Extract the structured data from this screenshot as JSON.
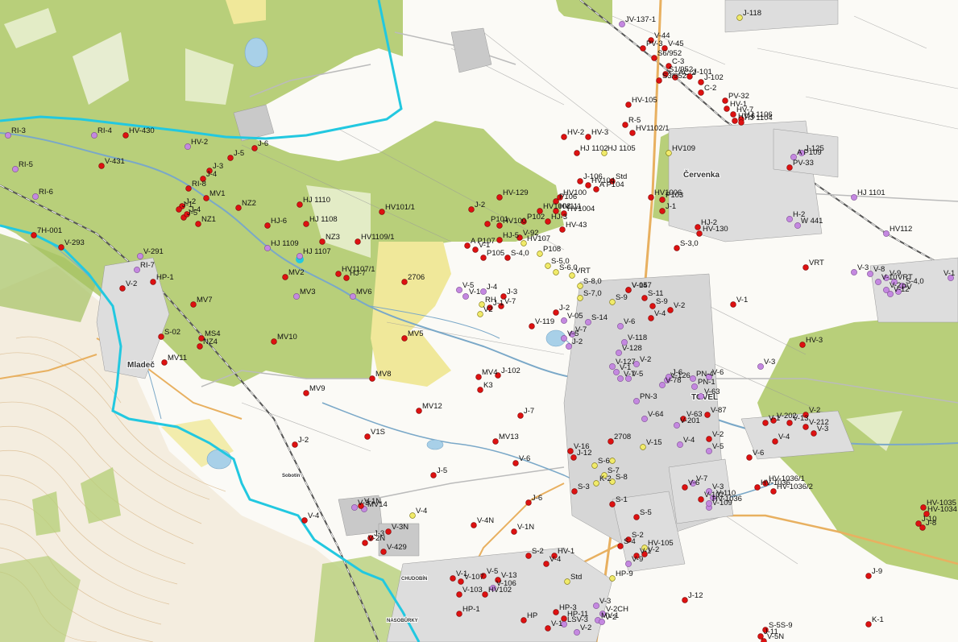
{
  "map": {
    "colors": {
      "forest": "#b8cf7a",
      "forest_dark": "#a5c262",
      "field": "#fbfaf6",
      "boundary": "#22c8e0",
      "river": "#7aa8c8",
      "borehole": "#dd1111",
      "piezometer": "#c488e0",
      "spring": "#f0ea6a",
      "settlement": "#c9c9c9"
    },
    "places": [
      {
        "id": "mladec",
        "text": "Mladeč"
      },
      {
        "id": "cervenka",
        "text": "Červenka"
      },
      {
        "id": "litovel",
        "text": "TOVEL"
      },
      {
        "id": "sobotin",
        "text": "Sobotín"
      },
      {
        "id": "chudobin",
        "text": "CHUDOBÍN"
      },
      {
        "id": "nasobuky",
        "text": "NASOBŮRKY"
      }
    ],
    "labels": [
      "JV-137-1",
      "J-118",
      "V-44",
      "PV-3",
      "V-45",
      "S6/952",
      "C-3",
      "J-101",
      "J-102",
      "S3/952",
      "AC-2",
      "S1/952",
      "C-2",
      "PV-32",
      "HV-105",
      "HV-7",
      "HJ 1106",
      "HV-1",
      "R-5",
      "HV-6",
      "HJ 1104",
      "HV-2",
      "HV-3",
      "HV1102/1",
      "HJ 1102",
      "HJ 1105",
      "HV109",
      "A P109",
      "J-125",
      "PV-33",
      "J-106",
      "Std",
      "HV104",
      "A P104",
      "HV1006",
      "HJ 1101",
      "HV-129",
      "P106",
      "HV100",
      "P103",
      "J-1",
      "J-2",
      "HV1008",
      "HV111",
      "HV1004",
      "H-2",
      "W 441",
      "HJ-2",
      "HV101/1",
      "P101",
      "HV100",
      "HJ-3",
      "P102",
      "HV-43",
      "HV-130",
      "HV112",
      "HJ-5",
      "V-92",
      "HV107",
      "A P107",
      "V-1",
      "S-3,0",
      "P108",
      "P105",
      "S-4,0",
      "S-5,0",
      "S-6,0",
      "VRT",
      "VRT",
      "V-3",
      "V-8",
      "V-9",
      "VRT",
      "V-2",
      "V-10",
      "PV",
      "V-1",
      "V-12",
      "S-4,0",
      "S-8,0",
      "V-157",
      "V-5",
      "V-1",
      "J-4",
      "J-3",
      "V-7",
      "RH",
      "V2",
      "J-1",
      "J-2",
      "S-7,0",
      "S-9",
      "S-11",
      "S-9",
      "V-2",
      "V-1",
      "V-04",
      "V-05",
      "S-14",
      "V-4",
      "V-6",
      "V-7",
      "V-5",
      "J-2",
      "V-119",
      "V-118",
      "V-128",
      "V-2",
      "V-1",
      "V-127",
      "V-5",
      "V-126",
      "V-7",
      "J-6",
      "PN-4",
      "V-6",
      "V-78",
      "PN-3",
      "PN-1",
      "V-63",
      "V-64",
      "V-63",
      "V-201",
      "V-87",
      "V-1",
      "V-202",
      "V-2",
      "V-3",
      "HV-3",
      "V-13",
      "V-212",
      "V-3",
      "V-4",
      "V-2",
      "V-4",
      "V-5",
      "V-6",
      "V-7",
      "V-3",
      "V-6",
      "V-102",
      "V-109",
      "V-110",
      "HV-1036",
      "HV-1036",
      "HV-1036/1",
      "HV-1036/2",
      "HV-1035",
      "HV-1034",
      "J-10",
      "J-8",
      "J-9",
      "K-1",
      "S-1",
      "S-2",
      "S-3",
      "S-2",
      "S-4",
      "V-1",
      "V-2",
      "HV-1",
      "V-9",
      "HV-105",
      "V-4",
      "V-5",
      "V-13",
      "V-106",
      "V-1",
      "V-107",
      "V-103",
      "HV102",
      "Std",
      "HP-9",
      "HP-3",
      "HP-11",
      "HP-1",
      "HP",
      "V-1",
      "V-3",
      "MV-1",
      "V-2",
      "LSV-3",
      "V-2",
      "V-2CH",
      "J-12",
      "J-11",
      "V-5N",
      "V-4N",
      "V-1N",
      "V-2N",
      "V-3N",
      "J-5",
      "J-7",
      "J-6",
      "V-6",
      "V-4",
      "V-3",
      "MV14",
      "MV13",
      "MV12",
      "MV9",
      "MV8",
      "MV5",
      "MV4",
      "K3",
      "J-102",
      "V1S",
      "J-2",
      "V-4",
      "V-1N",
      "J-3",
      "V-429",
      "HV-430",
      "HV-2",
      "RI-4",
      "RI-3",
      "RI-5",
      "RI-6",
      "V-431",
      "J-6",
      "J-5",
      "J-3",
      "J-4",
      "RI-8",
      "J-2",
      "J-1",
      "J-5",
      "J-4",
      "MV1",
      "NZ1",
      "NZ2",
      "HJ 1110",
      "HJ-6",
      "HJ 1108",
      "NZ3",
      "HV1109/1",
      "HJ 1109",
      "HJ 1107",
      "HV1107/1",
      "HJ-7",
      "MV2",
      "MV3",
      "MV6",
      "MV7",
      "MV10",
      "HP-1",
      "V-2",
      "RI-7",
      "V-291",
      "V-293",
      "7H-001",
      "S-02",
      "MS4",
      "MV11",
      "NZ4",
      "2706",
      "2708",
      "S-5",
      "S-6",
      "S-7",
      "S-8",
      "K-2",
      "V-15",
      "V-16",
      "J-12",
      "S-5S-9"
    ]
  }
}
